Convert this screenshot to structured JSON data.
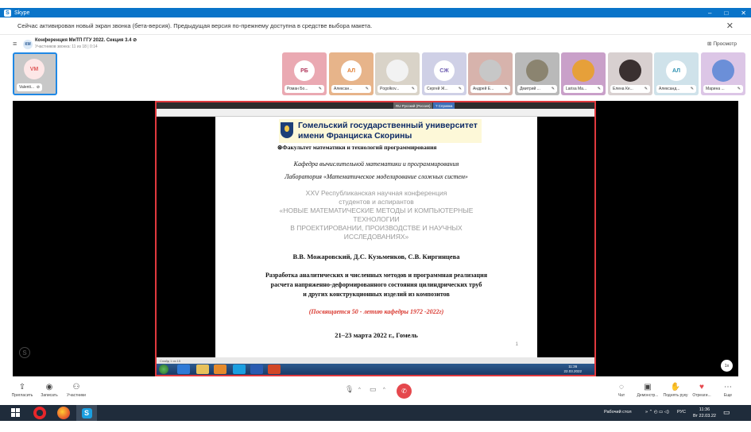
{
  "titlebar": {
    "app": "Skype",
    "icon": "S",
    "minimize": "–",
    "restore": "□",
    "close": "✕"
  },
  "notification": {
    "text": "Сейчас активирован новый экран звонка (бета-версия). Предыдущая версия по-прежнему доступна в средстве выбора макета.",
    "close": "✕"
  },
  "call": {
    "menu": "≡",
    "badge": "КМ",
    "title": "Конференция МиТП ГГУ 2022. Секция 3.4 ⊘",
    "subtitle": "Участников звонка: 11 из 18 | 0:14",
    "view_label": "Просмотр"
  },
  "self": {
    "initials": "VM",
    "name": "Valenti...",
    "muted": "⊘"
  },
  "participants": [
    {
      "initials": "РБ",
      "name": "Роман Бо...",
      "bg": "#eaa9b2",
      "fg": "#b23a5e",
      "photo": false
    },
    {
      "initials": "АЛ",
      "name": "Алексан...",
      "bg": "#e7b48a",
      "fg": "#e07b2e",
      "photo": false
    },
    {
      "initials": "",
      "name": "Pogolkov...",
      "bg": "#d9d3c8",
      "fg": "",
      "photo": true,
      "photo_color": "#f2f2f2"
    },
    {
      "initials": "СЖ",
      "name": "Сергей Ж...",
      "bg": "#cfd0e6",
      "fg": "#6c5bb0",
      "photo": false
    },
    {
      "initials": "",
      "name": "Андрей Е...",
      "bg": "#d7b3ac",
      "fg": "",
      "photo": true,
      "photo_color": "#c7c7c7"
    },
    {
      "initials": "",
      "name": "Дмитрий ...",
      "bg": "#b9b9b9",
      "fg": "",
      "photo": true,
      "photo_color": "#8b8470"
    },
    {
      "initials": "",
      "name": "Larisa Ma...",
      "bg": "#c9a0c9",
      "fg": "",
      "photo": true,
      "photo_color": "#e6a03a"
    },
    {
      "initials": "",
      "name": "Елена Ке...",
      "bg": "#d8d0d0",
      "fg": "",
      "photo": true,
      "photo_color": "#3a3030"
    },
    {
      "initials": "АЛ",
      "name": "Александ...",
      "bg": "#cfe2ea",
      "fg": "#2a8fb0",
      "photo": false
    },
    {
      "initials": "",
      "name": "Марина ...",
      "bg": "#dcc6e6",
      "fg": "",
      "photo": true,
      "photo_color": "#6b8fd8"
    }
  ],
  "presentation": {
    "lang_indicator": "RU Русский (Россия)",
    "help_label": "? Справка",
    "university_line1": "Гомельский государственный университет",
    "university_line2": "имени Франциска Скорины",
    "faculty": "Факультет математики и технологий программирования",
    "department": "Кафедра вычислительной математики и программирования",
    "laboratory": "Лаборатория «Математическое моделирование сложных систем»",
    "conference_lines": [
      "XXV Республиканская научная конференция",
      "студентов и аспирантов",
      "«НОВЫЕ МАТЕМАТИЧЕСКИЕ МЕТОДЫ И КОМПЬЮТЕРНЫЕ",
      "ТЕХНОЛОГИИ",
      "В ПРОЕКТИРОВАНИИ, ПРОИЗВОДСТВЕ И НАУЧНЫХ",
      "ИССЛЕДОВАНИЯХ»"
    ],
    "authors": "В.В. Можаровский, Д.С. Кузьменков, С.В. Киргинцева",
    "topic_lines": [
      "Разработка аналитических и численных методов и программная реализация",
      "расчета напряженно-деформированного состояния цилиндрических труб",
      "и других конструкционных изделий из композитов"
    ],
    "dedication": "(Посвящается 50 - летию кафедры  1972 -2022г)",
    "dates": "21–23 марта 2022 г., Гомель",
    "page_number": "1",
    "status_text": "Слайд 1 из 15",
    "remote_time": "11:36",
    "remote_date": "22.03.2022"
  },
  "zoom_chip": "1x",
  "controls": {
    "invite": "Пригласить",
    "record": "Записать",
    "participants": "Участники",
    "chat": "Чат",
    "share": "Демонстр...",
    "raise_hand": "Поднять руку",
    "react": "Отреаги...",
    "more": "Еще",
    "mic_icon": "🎙",
    "video_icon": "▭",
    "hangup_icon": "✆"
  },
  "taskbar": {
    "desktop_label": "Рабочий стол",
    "lang": "РУС",
    "time": "11:36",
    "date": "Вт 22.03.22"
  }
}
